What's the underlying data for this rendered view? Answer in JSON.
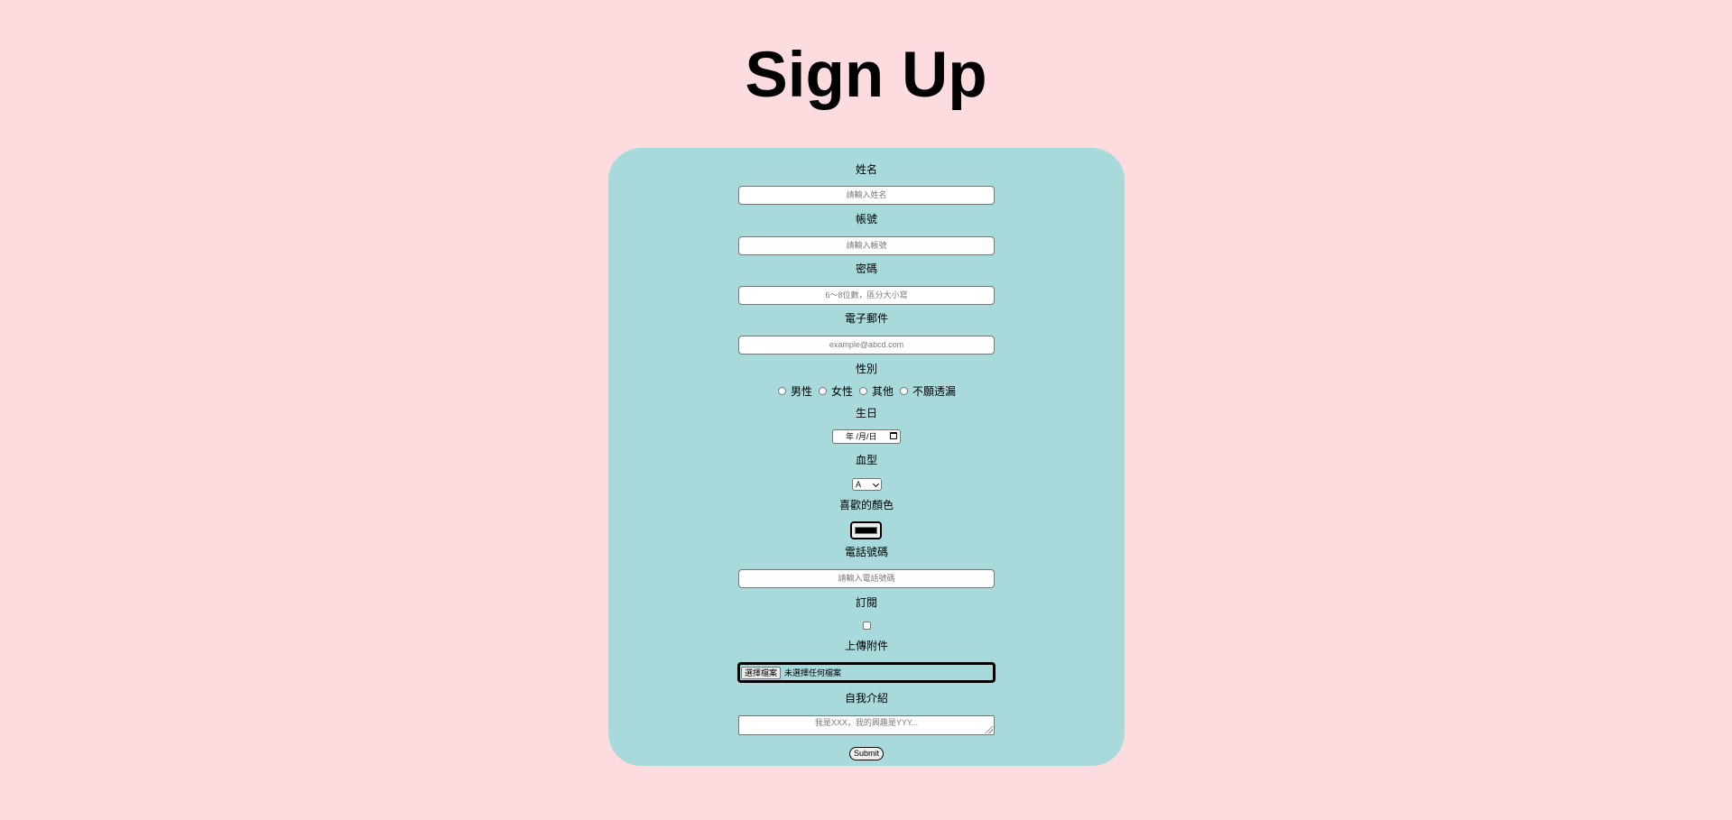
{
  "page": {
    "title": "Sign Up",
    "background_color": "#fcdcdf",
    "card_color": "#a8dadc"
  },
  "form": {
    "name": {
      "label": "姓名",
      "placeholder": "請輸入姓名"
    },
    "account": {
      "label": "帳號",
      "placeholder": "請輸入帳號"
    },
    "password": {
      "label": "密碼",
      "placeholder": "6～8位數，區分大小寫"
    },
    "email": {
      "label": "電子郵件",
      "placeholder": "example@abcd.com"
    },
    "gender": {
      "label": "性別",
      "options": [
        "男性",
        "女性",
        "其他",
        "不願透漏"
      ]
    },
    "birthday": {
      "label": "生日",
      "value": "年 /月/日"
    },
    "blood_type": {
      "label": "血型",
      "selected": "A"
    },
    "favorite_color": {
      "label": "喜歡的顏色",
      "value": "#000000"
    },
    "phone": {
      "label": "電話號碼",
      "placeholder": "請輸入電話號碼"
    },
    "subscribe": {
      "label": "訂閱",
      "checked": false
    },
    "attachment": {
      "label": "上傳附件",
      "button_label": "選擇檔案",
      "status": "未選擇任何檔案"
    },
    "intro": {
      "label": "自我介紹",
      "placeholder": "我是XXX，我的興趣是YYY..."
    },
    "submit_label": "Submit"
  }
}
